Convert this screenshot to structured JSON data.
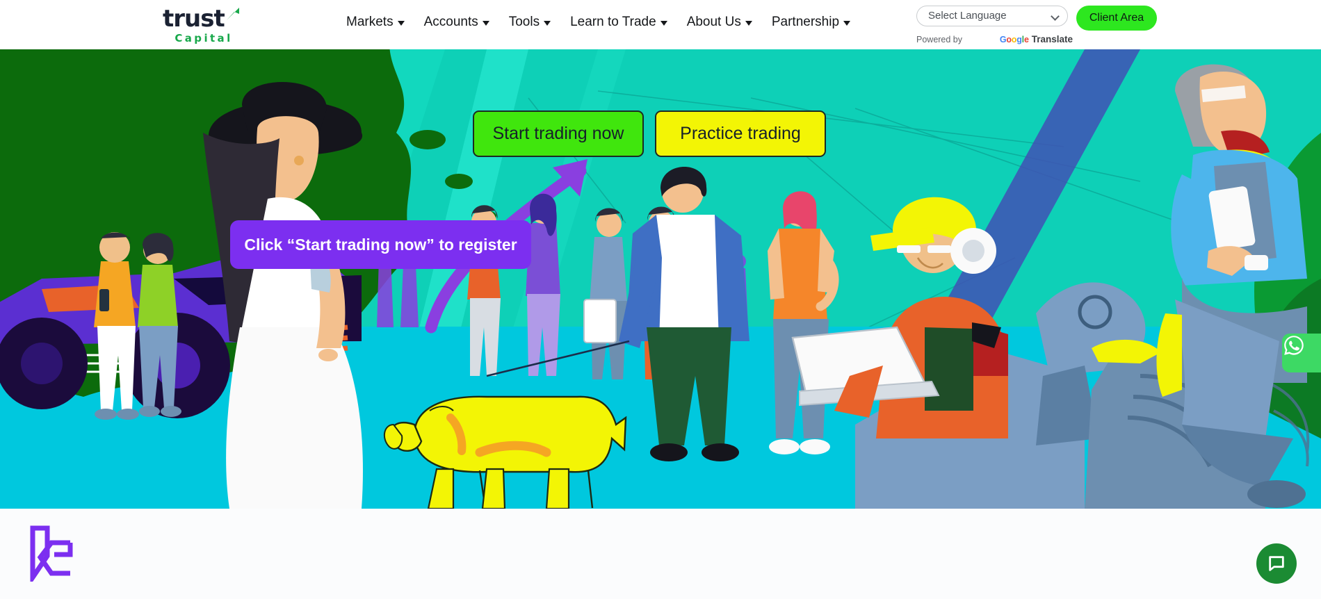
{
  "header": {
    "logo": {
      "name": "trust",
      "tagline": "Capital"
    },
    "nav": [
      {
        "label": "Markets",
        "has_dropdown": true
      },
      {
        "label": "Accounts",
        "has_dropdown": true
      },
      {
        "label": "Tools",
        "has_dropdown": true
      },
      {
        "label": "Learn to Trade",
        "has_dropdown": true
      },
      {
        "label": "About Us",
        "has_dropdown": true
      },
      {
        "label": "Partnership",
        "has_dropdown": true
      }
    ],
    "language": {
      "selected": "Select Language",
      "options": [
        "Select Language"
      ],
      "powered_by": "Powered by",
      "brand_google": "Google",
      "brand_translate": "Translate"
    },
    "client_area_label": "Client Area"
  },
  "hero": {
    "primary_button": "Start trading now",
    "secondary_button": "Practice trading",
    "callout": "Click “Start trading now” to register",
    "colors": {
      "sky": "#0ed0b7",
      "ground": "#00c8de",
      "primary_button": "#40e60d",
      "secondary_button": "#f3f505",
      "callout": "#7c2ff0",
      "foliage": "#0c6b0c"
    }
  },
  "floating": {
    "whatsapp_label": "WhatsApp",
    "whatsapp_color": "#3dd964",
    "livechat_label": "Live chat",
    "livechat_color": "#1b8b33"
  },
  "footer": {
    "logo_label": "LC monogram",
    "logo_color": "#7c2ff0"
  }
}
